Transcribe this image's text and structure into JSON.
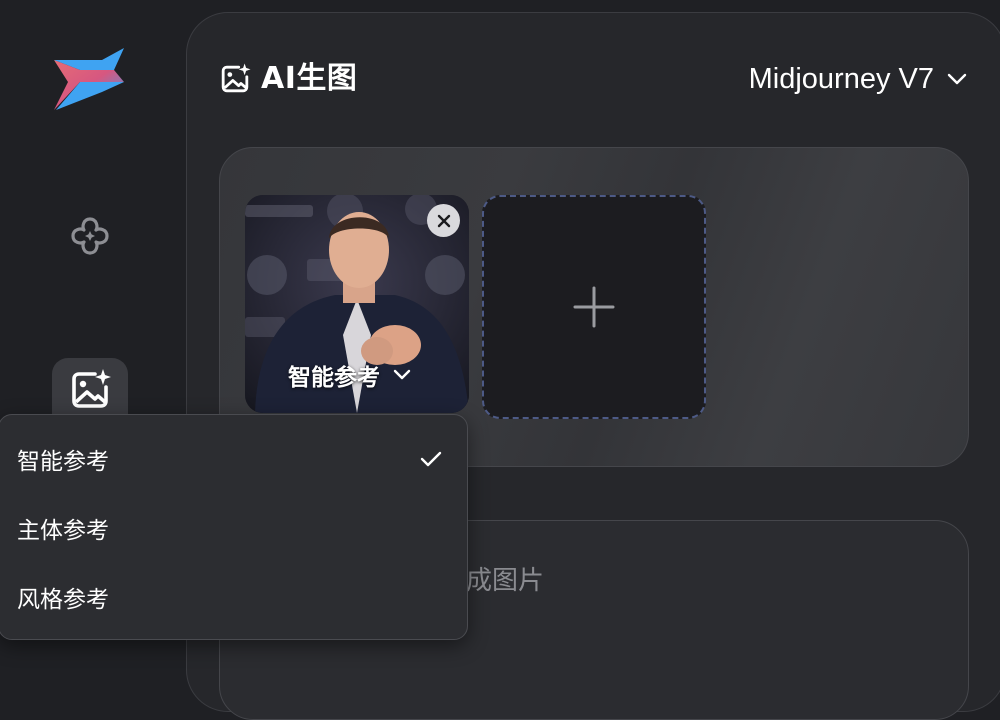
{
  "header": {
    "title": "AI生图",
    "model": "Midjourney V7"
  },
  "reference": {
    "mode_label": "智能参考"
  },
  "prompt": {
    "placeholder_visible": "成图片"
  },
  "menu": {
    "items": [
      {
        "label": "智能参考",
        "selected": true
      },
      {
        "label": "主体参考",
        "selected": false
      },
      {
        "label": "风格参考",
        "selected": false
      }
    ]
  },
  "colors": {
    "background": "#1f2024",
    "panel": "#26272b",
    "card": "#36373b",
    "accent_dash": "#4d5a86",
    "logo_blue": "#3fa3f2",
    "logo_pink": "#f0707a"
  },
  "icons": {
    "logo": "bolt-logo-icon",
    "discover": "clover-icon",
    "image_gen": "image-sparkle-icon",
    "close": "close-icon",
    "add": "plus-icon",
    "dropdown": "chevron-down-icon",
    "selected": "check-icon"
  }
}
